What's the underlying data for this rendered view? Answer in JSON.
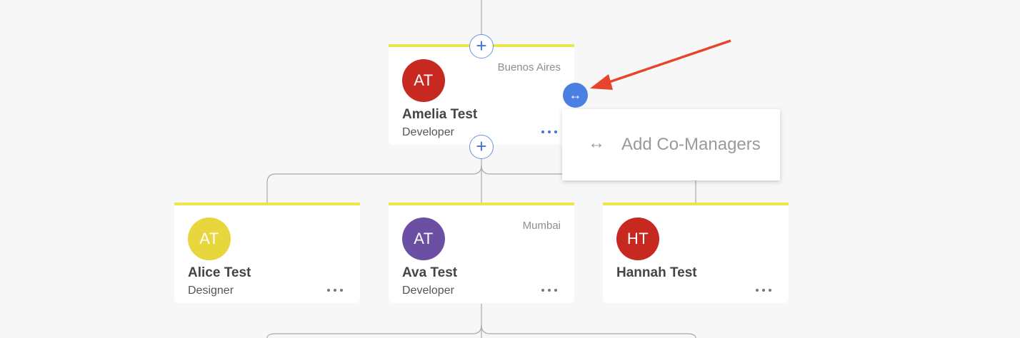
{
  "manager": {
    "initials": "AT",
    "name": "Amelia Test",
    "role": "Developer",
    "location": "Buenos Aires",
    "avatar_color": "#c7281f"
  },
  "reports": [
    {
      "initials": "AT",
      "name": "Alice Test",
      "role": "Designer",
      "location": "",
      "avatar_color": "#e8d73c"
    },
    {
      "initials": "AT",
      "name": "Ava Test",
      "role": "Developer",
      "location": "Mumbai",
      "avatar_color": "#6a4fa3"
    },
    {
      "initials": "HT",
      "name": "Hannah Test",
      "role": "",
      "location": "",
      "avatar_color": "#c7281f"
    }
  ],
  "popup": {
    "label": "Add Co-Managers",
    "icon": "arrows-horizontal-icon"
  },
  "buttons": {
    "plus": "+",
    "swap_icon": "arrows-horizontal-icon"
  },
  "colors": {
    "accent": "#4a7fe3",
    "card_top_border": "#e9e74a",
    "annotation_arrow": "#e8432b"
  }
}
